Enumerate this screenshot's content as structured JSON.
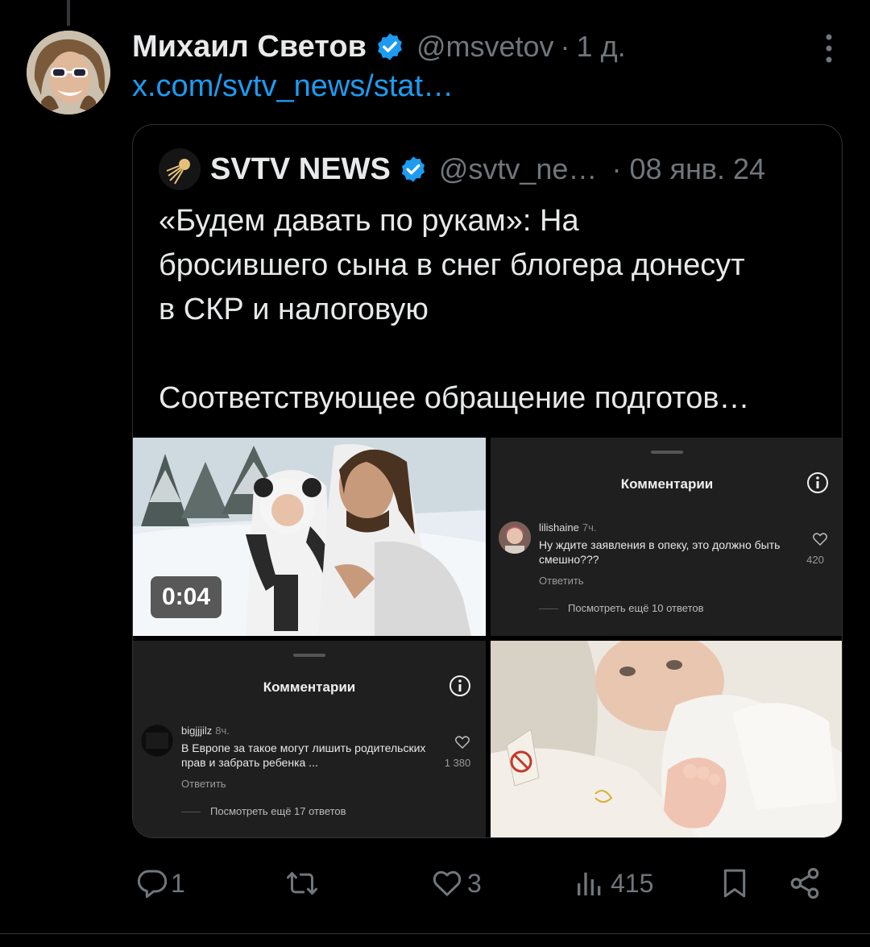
{
  "tweet": {
    "author_name": "Михаил Светов",
    "author_handle": "@msvetov",
    "separator": "·",
    "time": "1 д.",
    "link_text": "x.com/svtv_news/stat…"
  },
  "quote": {
    "name": "SVTV NEWS",
    "handle": "@svtv_ne…",
    "separator": "·",
    "date": "08 янв. 24",
    "text_line1": "«Будем давать по рукам»: На",
    "text_line2": "бросившего сына в снег блогера донесут",
    "text_line3": "в СКР и налоговую",
    "text_line4": "Соответствующее обращение подготов…"
  },
  "media": {
    "video_duration": "0:04",
    "comment_card_1": {
      "title": "Комментарии",
      "username": "lilishaine",
      "age": "7ч.",
      "text": "Ну ждите заявления в опеку, это должно быть смешно???",
      "likes": "420",
      "reply": "Ответить",
      "more": "Посмотреть ещё 10 ответов"
    },
    "comment_card_2": {
      "title": "Комментарии",
      "username": "bigjjjilz",
      "age": "8ч.",
      "text": "В Европе за такое могут лишить родительских прав и забрать ребенка ...",
      "likes": "1 380",
      "reply": "Ответить",
      "more": "Посмотреть ещё 17 ответов"
    }
  },
  "actions": {
    "replies": "1",
    "retweets": "",
    "likes": "3",
    "views": "415"
  },
  "colors": {
    "background": "#000000",
    "link": "#1d9bf0",
    "muted": "#71767b",
    "verified": "#1d9bf0"
  }
}
